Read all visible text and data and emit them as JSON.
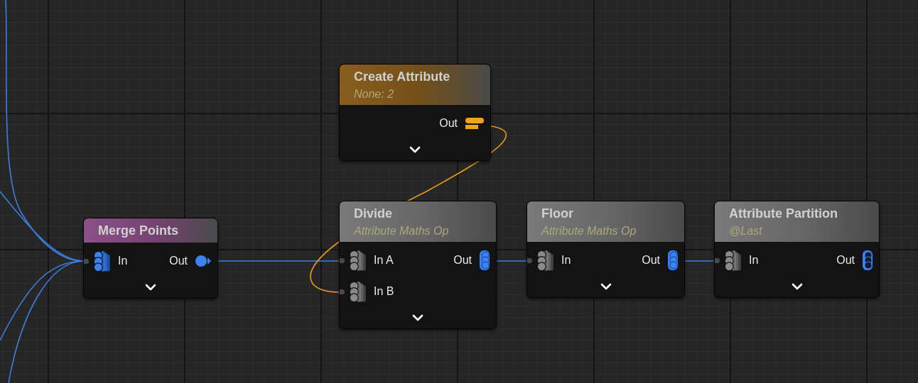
{
  "nodes": [
    {
      "title": "Merge Points",
      "color": "#8c4f88",
      "inputs": [
        {
          "label": "In",
          "kind": "spatial"
        }
      ],
      "outputs": [
        {
          "label": "Out",
          "kind": "point"
        }
      ]
    },
    {
      "title": "Create Attribute",
      "subtitle": "None: 2",
      "color": "#8a5e1c",
      "outputs": [
        {
          "label": "Out",
          "kind": "attribute"
        }
      ]
    },
    {
      "title": "Divide",
      "subtitle": "Attribute Maths Op",
      "color": "#7a7a7a",
      "inputs": [
        {
          "label": "In A",
          "kind": "any"
        },
        {
          "label": "In B",
          "kind": "any"
        }
      ],
      "outputs": [
        {
          "label": "Out",
          "kind": "param"
        }
      ]
    },
    {
      "title": "Floor",
      "subtitle": "Attribute Maths Op",
      "color": "#7a7a7a",
      "inputs": [
        {
          "label": "In",
          "kind": "any"
        }
      ],
      "outputs": [
        {
          "label": "Out",
          "kind": "param"
        }
      ]
    },
    {
      "title": "Attribute Partition",
      "subtitle": "@Last",
      "color": "#7a7a7a",
      "inputs": [
        {
          "label": "In",
          "kind": "any"
        }
      ],
      "outputs": [
        {
          "label": "Out",
          "kind": "param-dark"
        }
      ]
    }
  ]
}
